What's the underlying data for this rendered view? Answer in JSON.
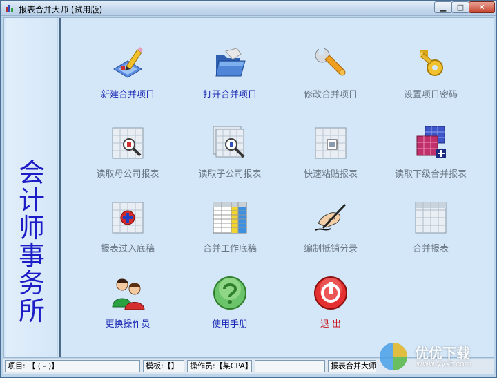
{
  "window": {
    "title": "报表合并大师 (试用版)",
    "min_glyph": "▁",
    "max_glyph": "□",
    "close_glyph": "✕"
  },
  "sidebar": {
    "chars": [
      "会",
      "计",
      "师",
      "事",
      "务",
      "所"
    ],
    "color": "#1d1dc8"
  },
  "tiles": [
    {
      "id": "new-merge-project",
      "label": "新建合并项目",
      "icon": "pencil-edit-icon",
      "state": "enabled"
    },
    {
      "id": "open-merge-project",
      "label": "打开合并项目",
      "icon": "folder-open-icon",
      "state": "enabled"
    },
    {
      "id": "modify-merge-project",
      "label": "修改合并项目",
      "icon": "wrench-icon",
      "state": "disabled"
    },
    {
      "id": "set-project-password",
      "label": "设置项目密码",
      "icon": "key-icon",
      "state": "disabled"
    },
    {
      "id": "read-parent-report",
      "label": "读取母公司报表",
      "icon": "grid-magnify-icon",
      "state": "disabled"
    },
    {
      "id": "read-subsidiary-report",
      "label": "读取子公司报表",
      "icon": "stacked-grid-magnify-icon",
      "state": "disabled"
    },
    {
      "id": "quick-paste-report",
      "label": "快速粘贴报表",
      "icon": "grid-paste-icon",
      "state": "disabled"
    },
    {
      "id": "read-lower-merge-report",
      "label": "读取下级合并报表",
      "icon": "color-grid-plus-icon",
      "state": "disabled"
    },
    {
      "id": "report-to-draft",
      "label": "报表过入底稿",
      "icon": "grid-plus-icon",
      "state": "disabled"
    },
    {
      "id": "merge-working-draft",
      "label": "合并工作底稿",
      "icon": "spreadsheet-icon",
      "state": "disabled"
    },
    {
      "id": "compile-elimination",
      "label": "编制抵销分录",
      "icon": "hand-writing-icon",
      "state": "disabled"
    },
    {
      "id": "merged-report",
      "label": "合并报表",
      "icon": "grid-icon",
      "state": "disabled"
    },
    {
      "id": "switch-operator",
      "label": "更换操作员",
      "icon": "users-icon",
      "state": "enabled"
    },
    {
      "id": "user-manual",
      "label": "使用手册",
      "icon": "help-icon",
      "state": "enabled"
    },
    {
      "id": "exit",
      "label": "退 出",
      "icon": "power-icon",
      "state": "exit"
    }
  ],
  "statusbar": {
    "project": "项目:      【                    ( - )】",
    "template": "模板:【】",
    "operator": "操作员:【某CPA】",
    "blank": "",
    "app_name": "报表合并大师"
  },
  "watermark": {
    "text": "优优下载",
    "url": "www.yyxt.com"
  },
  "colors": {
    "enabled_label": "#1a28b4",
    "disabled_label": "#6a7784",
    "exit_label": "#c8161c",
    "client_bg": "#d4e7f8"
  }
}
